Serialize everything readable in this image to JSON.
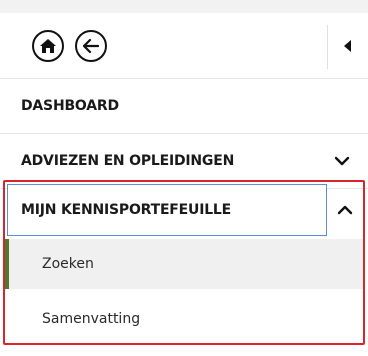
{
  "nav": {
    "home_icon": "home-icon",
    "back_icon": "arrow-left-icon",
    "collapse_icon": "caret-left-icon"
  },
  "menu": {
    "dashboard": "DASHBOARD",
    "adviezen": "ADVIEZEN EN OPLEIDINGEN",
    "mijn": "MIJN KENNISPORTEFEUILLE",
    "submenu": [
      "Zoeken",
      "Samenvatting"
    ]
  },
  "colors": {
    "highlight_border": "#d9262e",
    "focus_border": "#5b8fd9",
    "active_indicator": "#4e7a2a",
    "active_bg": "#f0f0f0"
  }
}
